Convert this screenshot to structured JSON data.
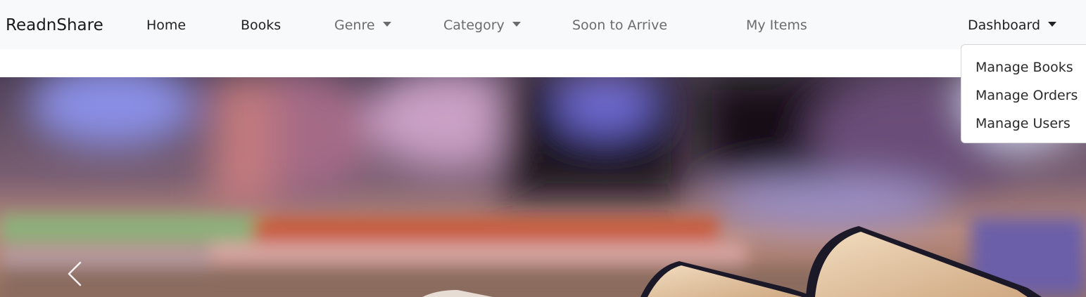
{
  "navbar": {
    "brand": "ReadnShare",
    "links": {
      "home": "Home",
      "books": "Books",
      "genre": "Genre",
      "category": "Category",
      "soon": "Soon to Arrive",
      "my_items": "My Items",
      "dashboard": "Dashboard"
    }
  },
  "dashboard_menu": {
    "items": [
      "Manage Books",
      "Manage Orders",
      "Manage Users"
    ]
  },
  "carousel": {
    "image": "blurred-bookshelf-with-open-books",
    "prev_icon": "chevron-left-icon"
  },
  "colors": {
    "navbar_bg": "#f8f9fa",
    "text_dark": "#222222",
    "text_muted": "#6c6c6c"
  }
}
